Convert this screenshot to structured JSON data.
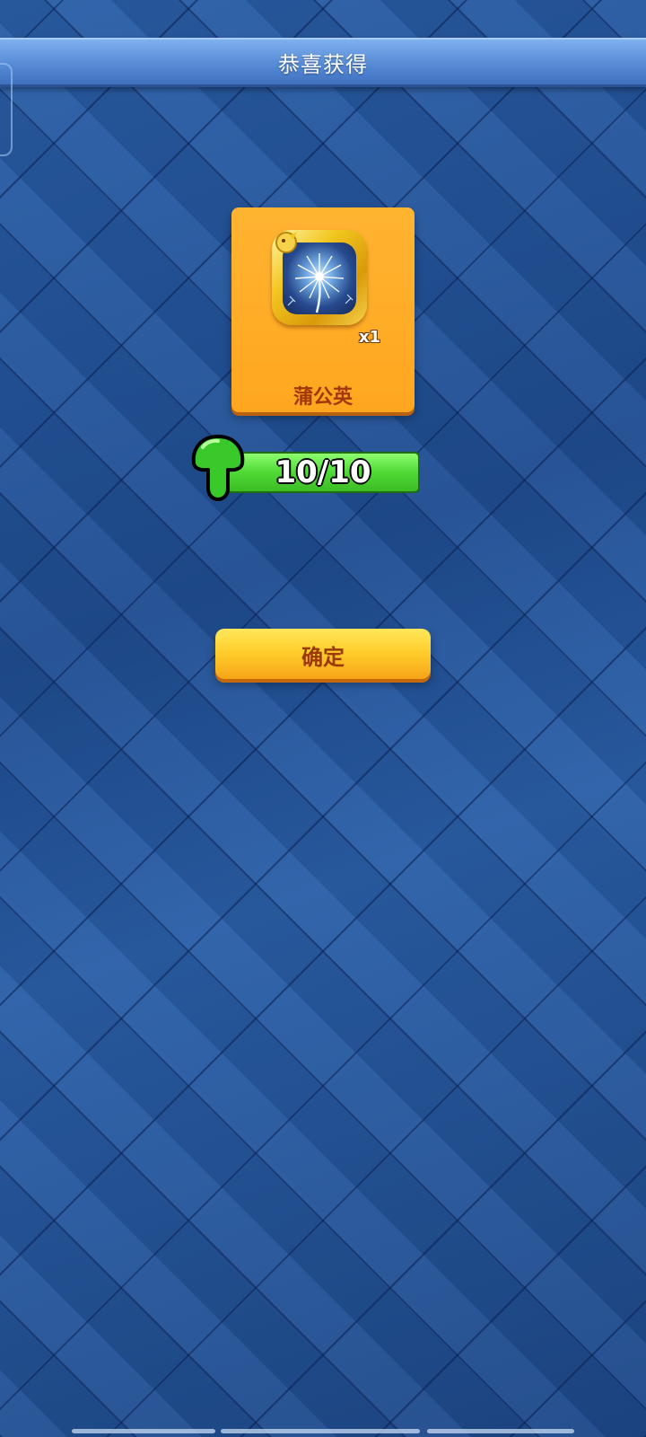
{
  "header": {
    "title": "恭喜获得"
  },
  "reward": {
    "item_name": "蒲公英",
    "quantity_label": "x1",
    "icon": "dandelion-icon"
  },
  "progress": {
    "text": "10/10",
    "fraction": 1.0,
    "icon": "green-mushroom-icon"
  },
  "actions": {
    "confirm_label": "确定"
  },
  "colors": {
    "background": "#25559a",
    "title_bar": "#5a8ed8",
    "card": "#ffa61f",
    "progress_fill": "#4fd936",
    "button": "#ffcf2c",
    "button_text": "#9b3a08"
  }
}
